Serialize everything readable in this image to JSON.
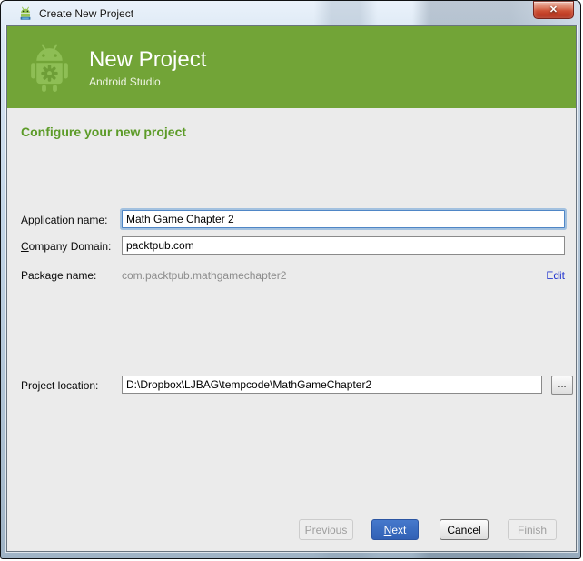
{
  "window": {
    "title": "Create New Project",
    "close_glyph": "✕"
  },
  "header": {
    "title": "New Project",
    "subtitle": "Android Studio",
    "background_color": "#72A437",
    "robot_color": "#8EBE55"
  },
  "main": {
    "heading": "Configure your new project",
    "heading_color": "#5C9B28"
  },
  "form": {
    "application_name": {
      "mnemonic": "A",
      "label_rest": "pplication name:",
      "value": "Math Game Chapter 2",
      "focused": true
    },
    "company_domain": {
      "mnemonic": "C",
      "label_rest": "ompany Domain:",
      "value": "packtpub.com"
    },
    "package_name": {
      "label": "Package name:",
      "value": "com.packtpub.mathgamechapter2",
      "edit_label": "Edit",
      "edit_color": "#2638CF"
    },
    "project_location": {
      "label": "Project location:",
      "value": "D:\\Dropbox\\LJBAG\\tempcode\\MathGameChapter2",
      "browse_label": "..."
    }
  },
  "buttons": {
    "previous": {
      "label": "Previous",
      "enabled": false
    },
    "next": {
      "mnemonic": "N",
      "label_rest": "ext",
      "enabled": true,
      "color": "#3D6FC4"
    },
    "cancel": {
      "label": "Cancel",
      "enabled": true
    },
    "finish": {
      "label": "Finish",
      "enabled": false
    }
  }
}
